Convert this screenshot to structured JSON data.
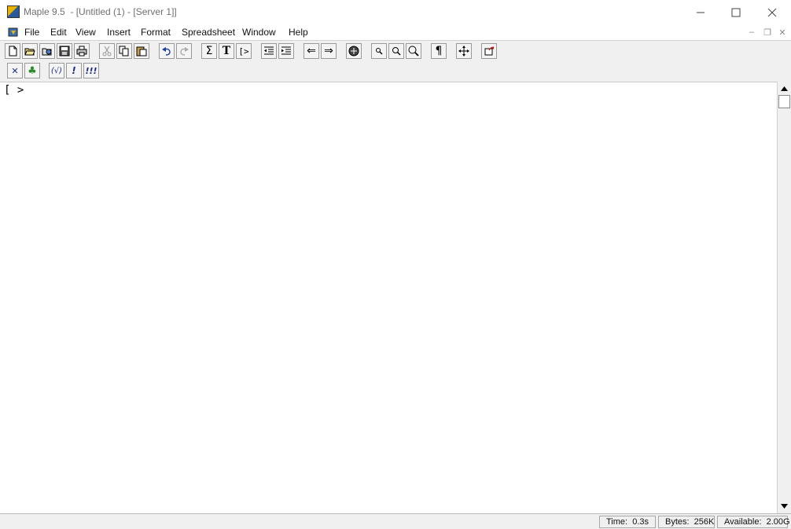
{
  "window": {
    "title": "Maple 9.5  - [Untitled (1) - [Server 1]]",
    "controls": {
      "minimize": "—",
      "maximize": "☐",
      "close": "✕"
    }
  },
  "menubar": {
    "items": [
      "File",
      "Edit",
      "View",
      "Insert",
      "Format",
      "Spreadsheet",
      "Window",
      "Help"
    ],
    "mdi_controls": {
      "minimize": "–",
      "restore": "❐",
      "close": "✕"
    }
  },
  "toolbar1": {
    "buttons": [
      {
        "name": "new-document",
        "icon": "page-icon"
      },
      {
        "name": "open",
        "icon": "folder-open-icon"
      },
      {
        "name": "open-url",
        "icon": "web-open-icon"
      },
      {
        "name": "save",
        "icon": "floppy-disk-icon"
      },
      {
        "name": "print",
        "icon": "printer-icon"
      },
      {
        "name": "cut",
        "icon": "scissors-icon",
        "disabled": true
      },
      {
        "name": "copy",
        "icon": "copy-icon"
      },
      {
        "name": "paste",
        "icon": "paste-icon"
      },
      {
        "name": "undo",
        "icon": "undo-icon"
      },
      {
        "name": "redo",
        "icon": "redo-icon",
        "disabled": true
      },
      {
        "name": "math-input",
        "icon": "sigma-icon",
        "glyph": "Σ"
      },
      {
        "name": "text-input",
        "icon": "text-t-icon",
        "glyph": "T"
      },
      {
        "name": "new-execution-group",
        "icon": "prompt-icon",
        "glyph": "[>"
      },
      {
        "name": "outdent",
        "icon": "outdent-icon"
      },
      {
        "name": "indent",
        "icon": "indent-icon"
      },
      {
        "name": "back",
        "icon": "arrow-left-icon",
        "glyph": "⇐"
      },
      {
        "name": "forward",
        "icon": "arrow-right-icon",
        "glyph": "⇒"
      },
      {
        "name": "stop",
        "icon": "stop-icon"
      },
      {
        "name": "zoom-100",
        "icon": "magnifier-small-icon"
      },
      {
        "name": "zoom-150",
        "icon": "magnifier-medium-icon"
      },
      {
        "name": "zoom-200",
        "icon": "magnifier-large-icon"
      },
      {
        "name": "show-hidden",
        "icon": "pilcrow-icon",
        "glyph": "¶"
      },
      {
        "name": "resize-to-window",
        "icon": "move-arrows-icon"
      },
      {
        "name": "restart",
        "icon": "restart-icon"
      }
    ]
  },
  "toolbar2": {
    "buttons": [
      {
        "name": "stop-computation",
        "icon": "x-icon",
        "glyph": "✕"
      },
      {
        "name": "maple-leaf",
        "icon": "maple-leaf-icon",
        "glyph": "♣"
      },
      {
        "name": "execute-selection",
        "icon": "execute-paren-icon",
        "glyph": "(√)"
      },
      {
        "name": "execute-group",
        "icon": "exclamation-icon",
        "glyph": "!"
      },
      {
        "name": "execute-worksheet",
        "icon": "triple-exclamation-icon",
        "glyph": "!!!"
      }
    ]
  },
  "worksheet": {
    "prompt": "[ >"
  },
  "statusbar": {
    "time": "Time:  0.3s",
    "bytes": "Bytes:  256K",
    "available": "Available:  2.00G"
  }
}
